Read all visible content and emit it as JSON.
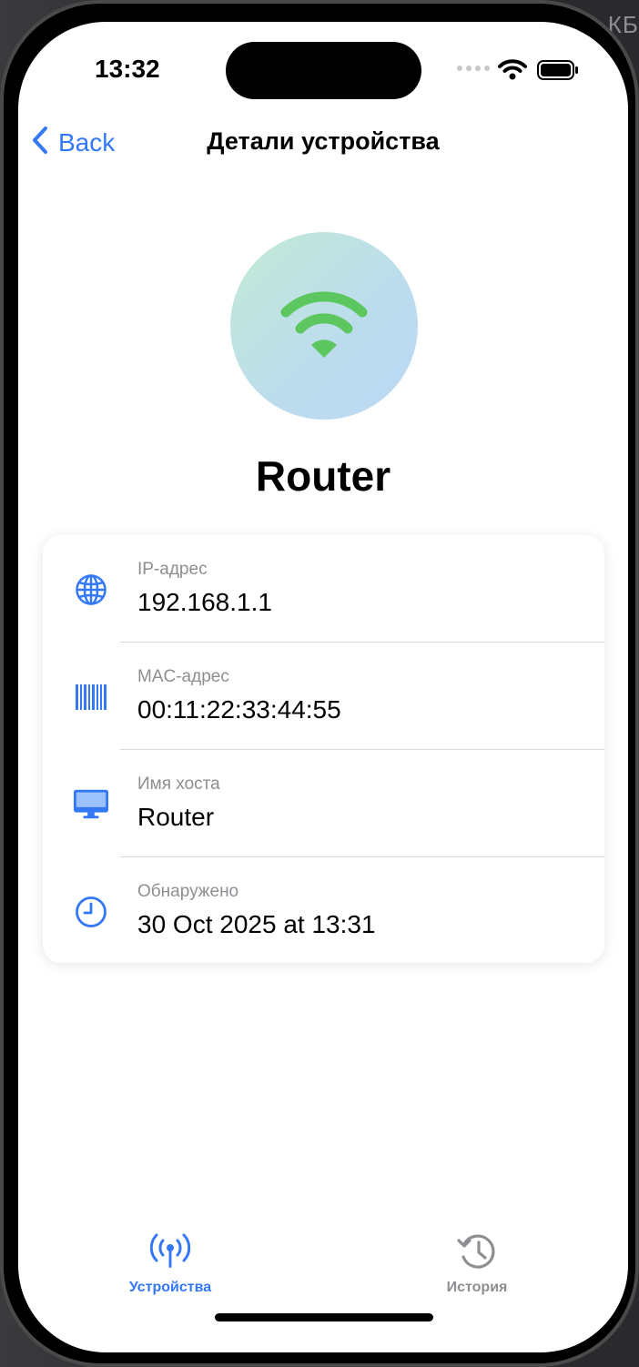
{
  "status_bar": {
    "time": "13:32"
  },
  "background": {
    "peek_text": "КБ"
  },
  "nav": {
    "back_label": "Back",
    "title": "Детали устройства"
  },
  "device": {
    "name": "Router",
    "icon": "wifi-icon"
  },
  "details": [
    {
      "icon": "globe-icon",
      "label": "IP-адрес",
      "value": "192.168.1.1"
    },
    {
      "icon": "barcode-icon",
      "label": "MAC-адрес",
      "value": "00:11:22:33:44:55"
    },
    {
      "icon": "desktop-icon",
      "label": "Имя хоста",
      "value": "Router"
    },
    {
      "icon": "clock-icon",
      "label": "Обнаружено",
      "value": "30 Oct 2025 at 13:31"
    }
  ],
  "tabs": [
    {
      "label": "Устройства",
      "icon": "antenna-icon",
      "selected": true
    },
    {
      "label": "История",
      "icon": "history-icon",
      "selected": false
    }
  ],
  "colors": {
    "accent": "#3478f6",
    "wifi_green": "#5cc65f",
    "inactive": "#8e8e93"
  }
}
